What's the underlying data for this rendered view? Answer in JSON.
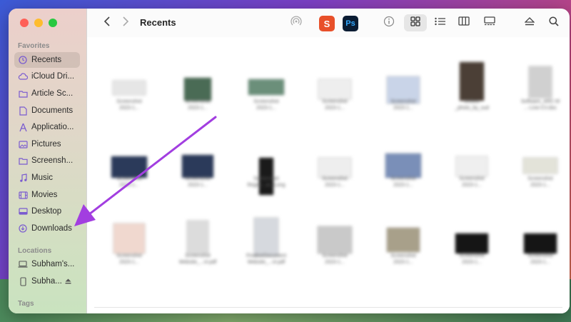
{
  "sidebar": {
    "favorites_title": "Favorites",
    "locations_title": "Locations",
    "tags_title": "Tags",
    "favorites": [
      {
        "label": "Recents",
        "icon": "clock-icon"
      },
      {
        "label": "iCloud Dri...",
        "icon": "cloud-icon"
      },
      {
        "label": "Article Sc...",
        "icon": "folder-icon"
      },
      {
        "label": "Documents",
        "icon": "document-icon"
      },
      {
        "label": "Applicatio...",
        "icon": "applications-icon"
      },
      {
        "label": "Pictures",
        "icon": "photo-icon"
      },
      {
        "label": "Screensh...",
        "icon": "folder-icon"
      },
      {
        "label": "Music",
        "icon": "music-icon"
      },
      {
        "label": "Movies",
        "icon": "film-icon"
      },
      {
        "label": "Desktop",
        "icon": "desktop-icon"
      },
      {
        "label": "Downloads",
        "icon": "download-icon"
      }
    ],
    "locations": [
      {
        "label": "Subham's...",
        "icon": "laptop-icon"
      },
      {
        "label": "Subha...",
        "icon": "phone-icon"
      }
    ]
  },
  "toolbar": {
    "title": "Recents",
    "app1_letter": "S",
    "app2_letter": "Ps"
  },
  "files": [
    {
      "name": "Screenshot\n2023-1...",
      "thumb": "#e6e6e6"
    },
    {
      "name": "Screenshot\n2023-1...",
      "thumb": "#4a6b55"
    },
    {
      "name": "Screenshot\n2023-1...",
      "thumb": "#6b8f7a"
    },
    {
      "name": "Screenshot\n2023-1...",
      "thumb": "#eeeeee"
    },
    {
      "name": "Screenshot\n2023-1...",
      "thumb": "#c9d4e8"
    },
    {
      "name": "tinified\n_photo_by_sud",
      "thumb": "#4b3f36"
    },
    {
      "name": "Software_ARC-M\n...-Line-CV.doc",
      "thumb": "#d0d0d0"
    },
    {
      "name": "Screenshot\n2023-1...",
      "thumb": "#2b3a5a"
    },
    {
      "name": "Screenshot\n2023-1...",
      "thumb": "#2b3a5a"
    },
    {
      "name": "Screenshot\nRegist...an_Long",
      "thumb": "#1a1a1a"
    },
    {
      "name": "Screenshot\n2023-1...",
      "thumb": "#eeeeee"
    },
    {
      "name": "Screenshot\n2023-1...",
      "thumb": "#7a8fb8"
    },
    {
      "name": "Screenshot\n2023-1...",
      "thumb": "#efefef"
    },
    {
      "name": "Screenshot\n2023-1...",
      "thumb": "#e3e3d9"
    },
    {
      "name": "Screenshot\n2023-1...",
      "thumb": "#f0d8cf"
    },
    {
      "name": "Screenshot\nWebsite_...nt.pdf",
      "thumb": "#dcdcdc"
    },
    {
      "name": "FinalizeDocument\nWebsite_...nt.pdf",
      "thumb": "#d6d9de"
    },
    {
      "name": "Screenshot\n2023-1...",
      "thumb": "#c9c9c9"
    },
    {
      "name": "Screenshot\n2023-1...",
      "thumb": "#a8a08a"
    },
    {
      "name": "Screenshot\n2023-1...",
      "thumb": "#151515"
    },
    {
      "name": "Screenshot\n2023-1...",
      "thumb": "#151515"
    }
  ]
}
